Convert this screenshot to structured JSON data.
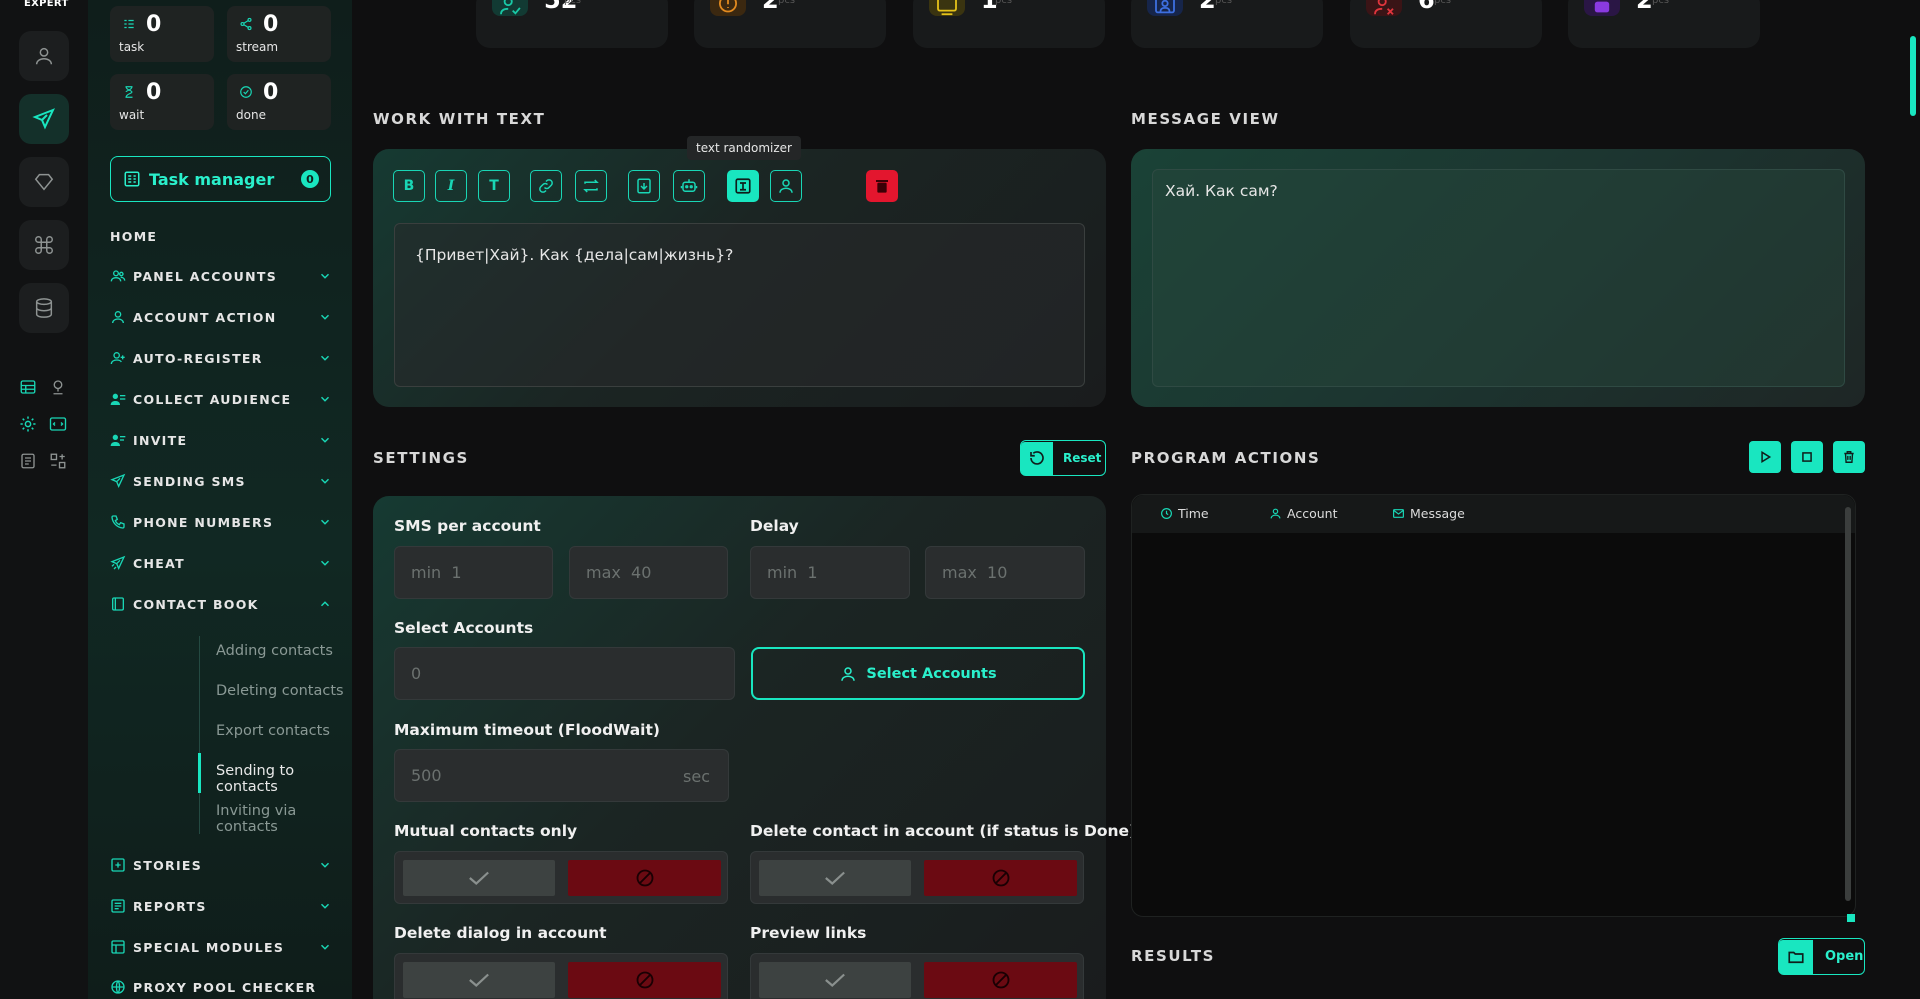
{
  "brand": "EXPERT",
  "stats": [
    {
      "value": "0",
      "label": "task"
    },
    {
      "value": "0",
      "label": "stream"
    },
    {
      "value": "0",
      "label": "wait"
    },
    {
      "value": "0",
      "label": "done"
    }
  ],
  "task_manager": {
    "label": "Task manager",
    "count": "0"
  },
  "nav": {
    "home": "HOME",
    "items": [
      "PANEL ACCOUNTS",
      "ACCOUNT ACTION",
      "AUTO-REGISTER",
      "COLLECT AUDIENCE",
      "INVITE",
      "SENDING SMS",
      "PHONE NUMBERS",
      "CHEAT",
      "CONTACT BOOK",
      "STORIES",
      "REPORTS",
      "SPECIAL MODULES",
      "PROXY POOL CHECKER"
    ],
    "contact_book_sub": [
      "Adding contacts",
      "Deleting contacts",
      "Export contacts",
      "Sending to contacts",
      "Inviting via contacts"
    ]
  },
  "top_stats": [
    {
      "value": "52",
      "unit": "pcs",
      "color": "#19c9a6"
    },
    {
      "value": "2",
      "unit": "pcs",
      "color": "#e28a1f"
    },
    {
      "value": "1",
      "unit": "pcs",
      "color": "#e5c21a"
    },
    {
      "value": "2",
      "unit": "pcs",
      "color": "#3d6fe0"
    },
    {
      "value": "6",
      "unit": "pcs",
      "color": "#e0353d"
    },
    {
      "value": "2",
      "unit": "pcs",
      "color": "#8a3ae0"
    }
  ],
  "work_with_text": {
    "title": "WORK WITH TEXT",
    "tooltip": "text randomizer",
    "text": "{Привет|Хай}. Как {дела|сам|жизнь}?"
  },
  "message_view": {
    "title": "MESSAGE VIEW",
    "text": "Хай. Как сам?"
  },
  "settings": {
    "title": "SETTINGS",
    "reset": "Reset",
    "sms_per_account": {
      "label": "SMS per account",
      "min_prefix": "min",
      "min": "1",
      "max_prefix": "max",
      "max": "40"
    },
    "delay": {
      "label": "Delay",
      "min_prefix": "min",
      "min": "1",
      "max_prefix": "max",
      "max": "10"
    },
    "select_accounts": {
      "label": "Select Accounts",
      "value": "0",
      "button": "Select Accounts"
    },
    "timeout": {
      "label": "Maximum timeout (FloodWait)",
      "value": "500",
      "unit": "sec"
    },
    "mutual": "Mutual contacts only",
    "delete_contact": "Delete contact in account (if status is Done)",
    "delete_dialog": "Delete dialog in account",
    "preview_links": "Preview links"
  },
  "program_actions": {
    "title": "PROGRAM ACTIONS",
    "columns": [
      "Time",
      "Account",
      "Message"
    ]
  },
  "results": {
    "title": "RESULTS",
    "open": "Open"
  }
}
